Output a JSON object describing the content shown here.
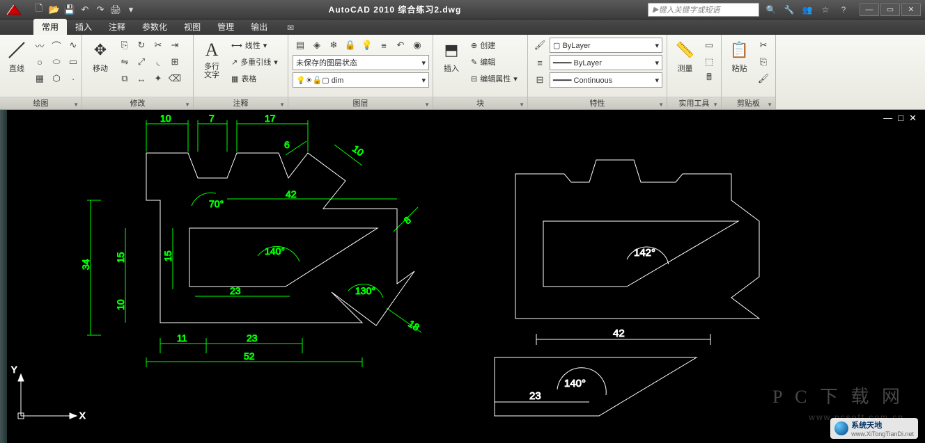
{
  "title": "AutoCAD 2010  综合练习2.dwg",
  "search_placeholder": "键入关键字或短语",
  "tabs": [
    "常用",
    "插入",
    "注释",
    "参数化",
    "视图",
    "管理",
    "输出"
  ],
  "active_tab": 0,
  "panels": {
    "draw": {
      "title": "绘图",
      "line": "直线"
    },
    "modify": {
      "title": "修改",
      "move": "移动"
    },
    "annotate": {
      "title": "注释",
      "mtext": "多行\n文字",
      "linear": "线性",
      "mleader": "多重引线",
      "table": "表格"
    },
    "layers": {
      "title": "图层",
      "state": "未保存的图层状态",
      "current": "dim"
    },
    "block": {
      "title": "块",
      "insert": "插入",
      "create": "创建",
      "edit": "编辑",
      "attr": "编辑属性"
    },
    "props": {
      "title": "特性",
      "layer": "ByLayer",
      "ltype": "ByLayer",
      "lweight": "Continuous"
    },
    "utils": {
      "title": "实用工具",
      "measure": "测量"
    },
    "clip": {
      "title": "剪贴板",
      "paste": "粘贴"
    }
  },
  "drawing": {
    "left_dims": {
      "d10a": "10",
      "d7": "7",
      "d17": "17",
      "d6": "6",
      "d10b": "10",
      "ang70": "70°",
      "d42": "42",
      "d8": "8",
      "d34": "34",
      "d15a": "15",
      "d15b": "15",
      "ang140": "140°",
      "d10c": "10",
      "d23a": "23",
      "ang130": "130°",
      "d18": "18",
      "d11": "11",
      "d23b": "23",
      "d52": "52"
    },
    "right_dims": {
      "ang142": "142°"
    },
    "bottom_dims": {
      "d42": "42",
      "ang140": "140°",
      "d23": "23"
    },
    "ucs": {
      "x": "X",
      "y": "Y"
    }
  },
  "viewport_controls": {
    "min": "—",
    "restore": "□",
    "close": "✕"
  },
  "watermark": {
    "big": "P C 下 载 网",
    "url": "www.pcsoft.com.cn",
    "brand": "系统天地",
    "brand_url": "www.XiTongTianDi.net"
  }
}
